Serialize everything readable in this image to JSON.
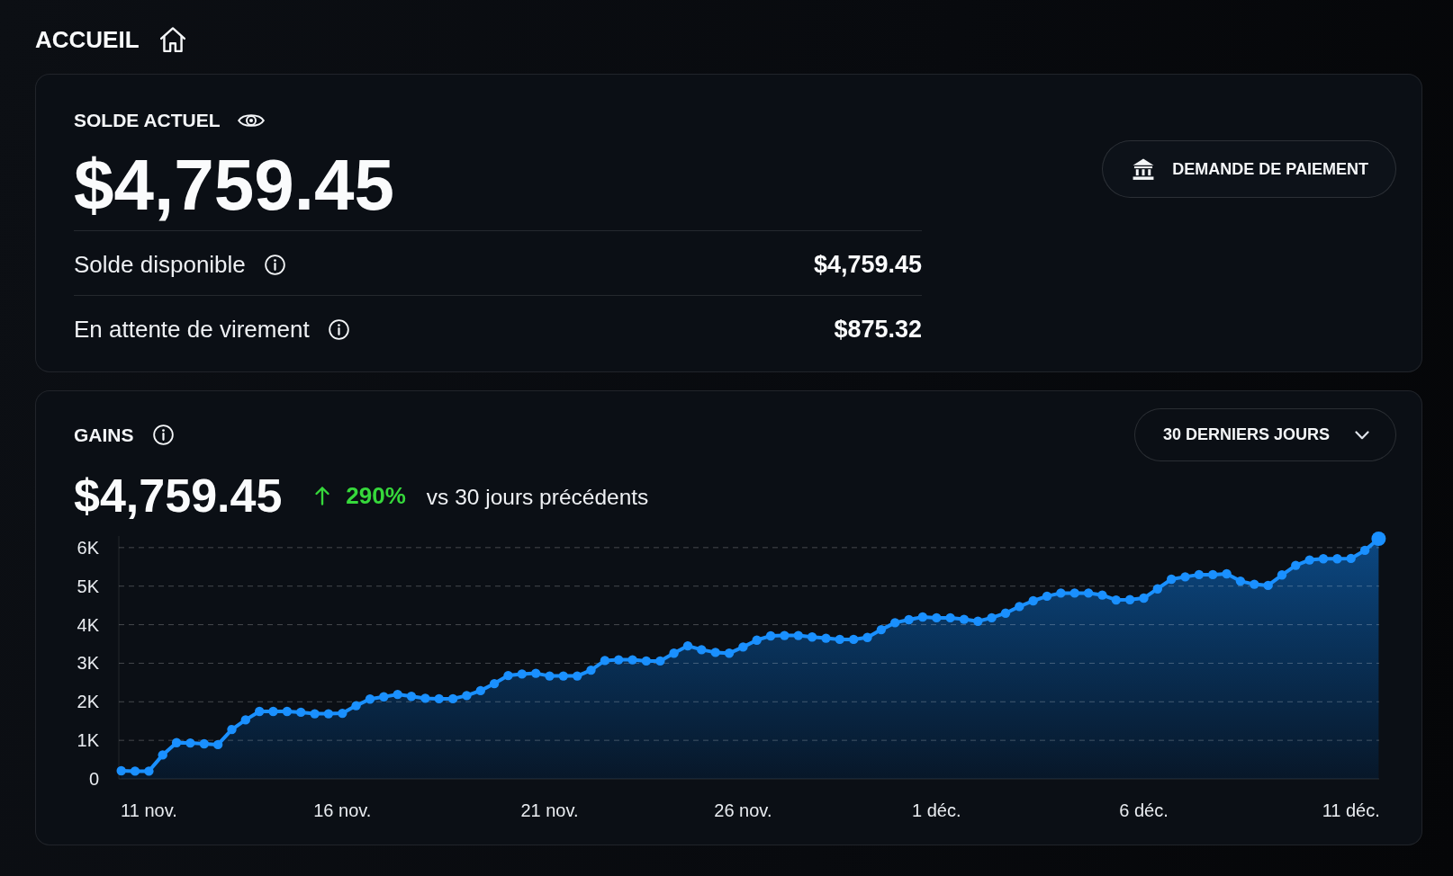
{
  "page": {
    "title": "ACCUEIL"
  },
  "balance_card": {
    "title": "SOLDE ACTUEL",
    "amount": "$4,759.45",
    "rows": [
      {
        "label": "Solde disponible",
        "value": "$4,759.45"
      },
      {
        "label": "En attente de virement",
        "value": "$875.32"
      }
    ],
    "action_button": {
      "label": "DEMANDE DE PAIEMENT"
    }
  },
  "earnings_card": {
    "title": "GAINS",
    "period_dropdown": {
      "value": "30 DERNIERS JOURS"
    },
    "amount": "$4,759.45",
    "change": {
      "rising": true,
      "percent": "290%",
      "comparison": "vs 30 jours précédents"
    },
    "chart_data": {
      "type": "area",
      "grid": true,
      "categories": [
        null,
        null,
        "11 nov.",
        null,
        null,
        null,
        null,
        null,
        null,
        null,
        null,
        null,
        null,
        null,
        null,
        null,
        "16 nov.",
        null,
        null,
        null,
        null,
        null,
        null,
        null,
        null,
        null,
        null,
        null,
        null,
        null,
        null,
        "21 nov.",
        null,
        null,
        null,
        null,
        null,
        null,
        null,
        null,
        null,
        null,
        null,
        null,
        null,
        "26 nov.",
        null,
        null,
        null,
        null,
        null,
        null,
        null,
        null,
        null,
        null,
        null,
        null,
        null,
        "1 déc.",
        null,
        null,
        null,
        null,
        null,
        null,
        null,
        null,
        null,
        null,
        null,
        null,
        null,
        null,
        "6 déc.",
        null,
        null,
        null,
        null,
        null,
        null,
        null,
        null,
        null,
        null,
        null,
        null,
        null,
        null,
        "11 déc.",
        null,
        null
      ],
      "values": [
        210,
        200,
        200,
        620,
        940,
        930,
        910,
        890,
        1280,
        1530,
        1750,
        1750,
        1750,
        1730,
        1690,
        1690,
        1700,
        1900,
        2070,
        2130,
        2190,
        2140,
        2090,
        2080,
        2080,
        2160,
        2290,
        2470,
        2680,
        2720,
        2740,
        2670,
        2670,
        2670,
        2820,
        3070,
        3090,
        3090,
        3060,
        3060,
        3260,
        3450,
        3350,
        3280,
        3260,
        3420,
        3600,
        3710,
        3720,
        3720,
        3680,
        3650,
        3620,
        3620,
        3670,
        3870,
        4050,
        4130,
        4200,
        4180,
        4180,
        4140,
        4090,
        4180,
        4300,
        4470,
        4620,
        4740,
        4820,
        4820,
        4820,
        4770,
        4640,
        4650,
        4690,
        4930,
        5180,
        5240,
        5300,
        5300,
        5320,
        5130,
        5050,
        5020,
        5290,
        5540,
        5680,
        5710,
        5710,
        5720,
        5930,
        6230
      ],
      "ylim": [
        0,
        6300
      ],
      "yticks": [
        0,
        {
          "value": 1000,
          "label": "1K"
        },
        {
          "value": 2000,
          "label": "2K"
        },
        {
          "value": 3000,
          "label": "3K"
        },
        {
          "value": 4000,
          "label": "4K"
        },
        {
          "value": 5000,
          "label": "5K"
        },
        {
          "value": 6000,
          "label": "6K"
        }
      ]
    }
  }
}
